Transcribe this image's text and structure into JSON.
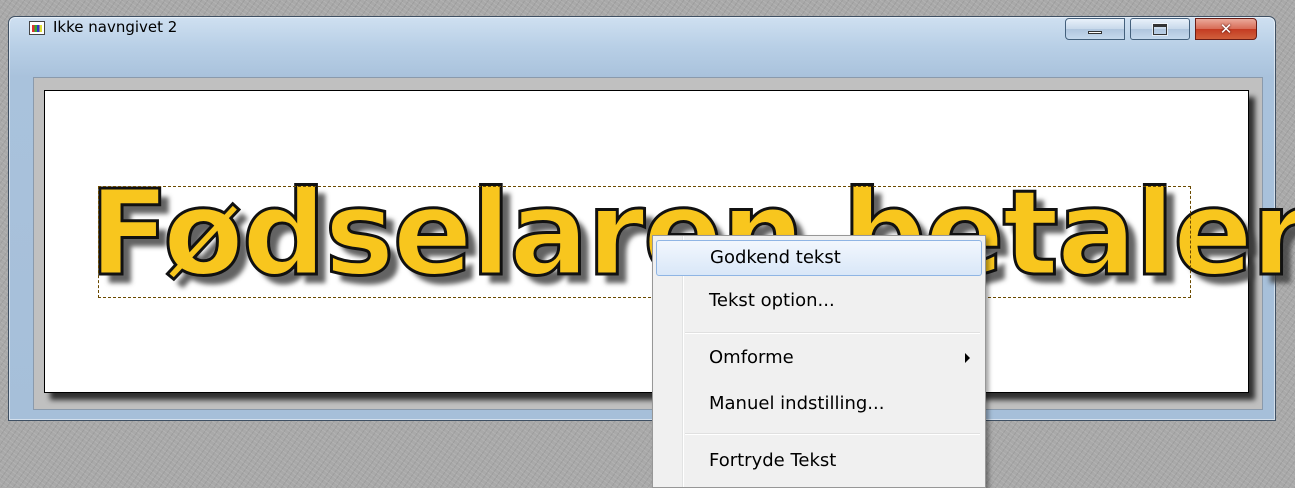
{
  "window": {
    "title": "Ikke navngivet 2",
    "controls": [
      "minimize",
      "maximize",
      "close"
    ],
    "close_glyph": "✕",
    "icon": "image-document-icon"
  },
  "canvas": {
    "text": "Fødselaren betaler",
    "text_color": "#f8c61e",
    "outline_color": "#111111"
  },
  "context_menu": {
    "items": [
      {
        "label": "Godkend tekst",
        "highlighted": true
      },
      {
        "label": "Tekst option..."
      },
      {
        "label": "Omforme",
        "submenu": true
      },
      {
        "label": "Manuel indstilling..."
      },
      {
        "label": "Fortryde Tekst"
      }
    ]
  },
  "colors": {
    "menu_highlight": "#d9e7f8",
    "close_button": "#c43b22",
    "desktop": "#a9a9a9"
  }
}
